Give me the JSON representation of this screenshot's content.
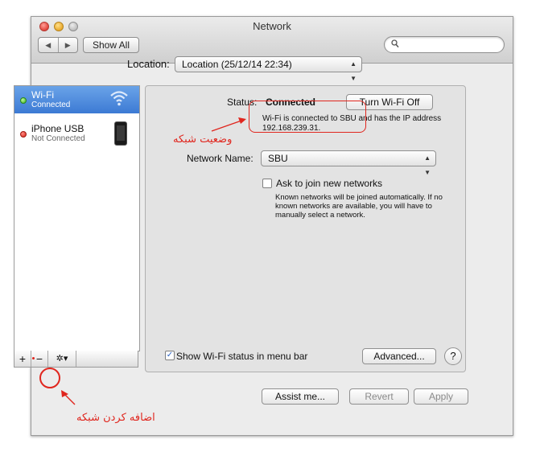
{
  "window": {
    "title": "Network"
  },
  "toolbar": {
    "back_label": "◀",
    "forward_label": "▶",
    "show_all_label": "Show All",
    "search_placeholder": ""
  },
  "location": {
    "label": "Location:",
    "value": "Location (25/12/14 22:34)"
  },
  "services": [
    {
      "name": "Wi-Fi",
      "status": "Connected",
      "selected": true,
      "status_color": "#37b21b",
      "icon": "wifi-icon"
    },
    {
      "name": "iPhone USB",
      "status": "Not Connected",
      "selected": false,
      "status_color": "#d81f14",
      "icon": "iphone-icon"
    }
  ],
  "list_controls": {
    "add_label": "+",
    "remove_label": "−",
    "gear_label": "✲▾"
  },
  "detail": {
    "status_label": "Status:",
    "status_value": "Connected",
    "turn_off_label": "Turn Wi-Fi Off",
    "status_desc": "Wi-Fi is connected to SBU and has the IP address 192.168.239.31.",
    "network_name_label": "Network Name:",
    "network_name_value": "SBU",
    "ask_join_label": "Ask to join new networks",
    "ask_join_checked": false,
    "ask_join_desc": "Known networks will be joined automatically. If no known networks are available, you will have to manually select a network.",
    "show_status_label": "Show Wi-Fi status in menu bar",
    "show_status_checked": true,
    "advanced_label": "Advanced...",
    "help_label": "?"
  },
  "footer": {
    "assist_label": "Assist me...",
    "revert_label": "Revert",
    "apply_label": "Apply"
  },
  "annotations": {
    "status_note": "وضعیت شبکه",
    "add_note": "اضافه کردن شبکه",
    "color": "#e0261e"
  }
}
